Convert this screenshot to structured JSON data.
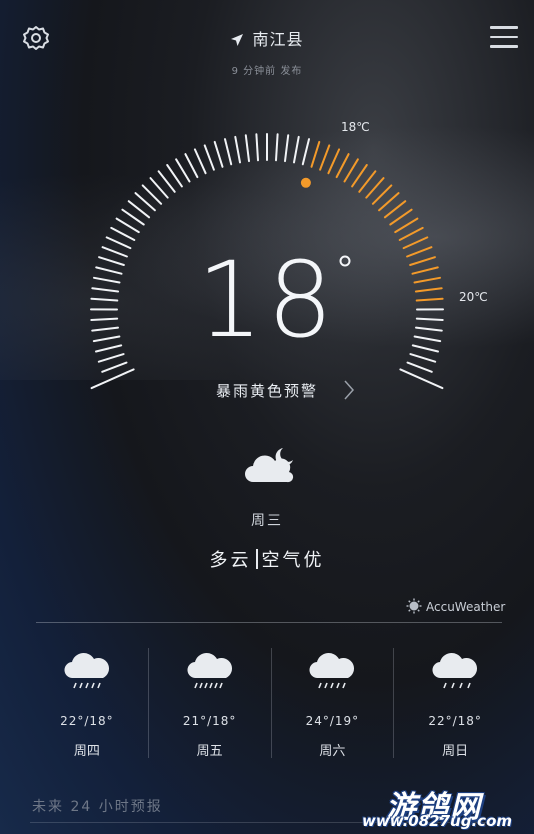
{
  "header": {
    "location": "南江县",
    "published": "9 分钟前 发布",
    "settings_icon": "gear-icon",
    "menu_icon": "menu-icon",
    "location_icon": "location-arrow-icon"
  },
  "current": {
    "temperature": "18",
    "temp_high_label": "18℃",
    "temp_low_label": "20℃",
    "alert": "暴雨黄色预警",
    "weather_icon": "partly-cloudy-night-icon",
    "weekday": "周三",
    "condition": "多云",
    "air_quality": "空气优"
  },
  "dial": {
    "accent_color": "#f39a2a",
    "tick_color": "#f1f3f6"
  },
  "provider": "AccuWeather",
  "forecast": [
    {
      "range": "22°/18°",
      "day": "周四",
      "icon": "rain-cloud-icon"
    },
    {
      "range": "21°/18°",
      "day": "周五",
      "icon": "rain-cloud-icon"
    },
    {
      "range": "24°/19°",
      "day": "周六",
      "icon": "rain-cloud-icon"
    },
    {
      "range": "22°/18°",
      "day": "周日",
      "icon": "rain-cloud-icon"
    }
  ],
  "hourly_title": "未来 24 小时预报",
  "watermark": {
    "name": "游鸽网",
    "url": "www.0827ug.com"
  }
}
